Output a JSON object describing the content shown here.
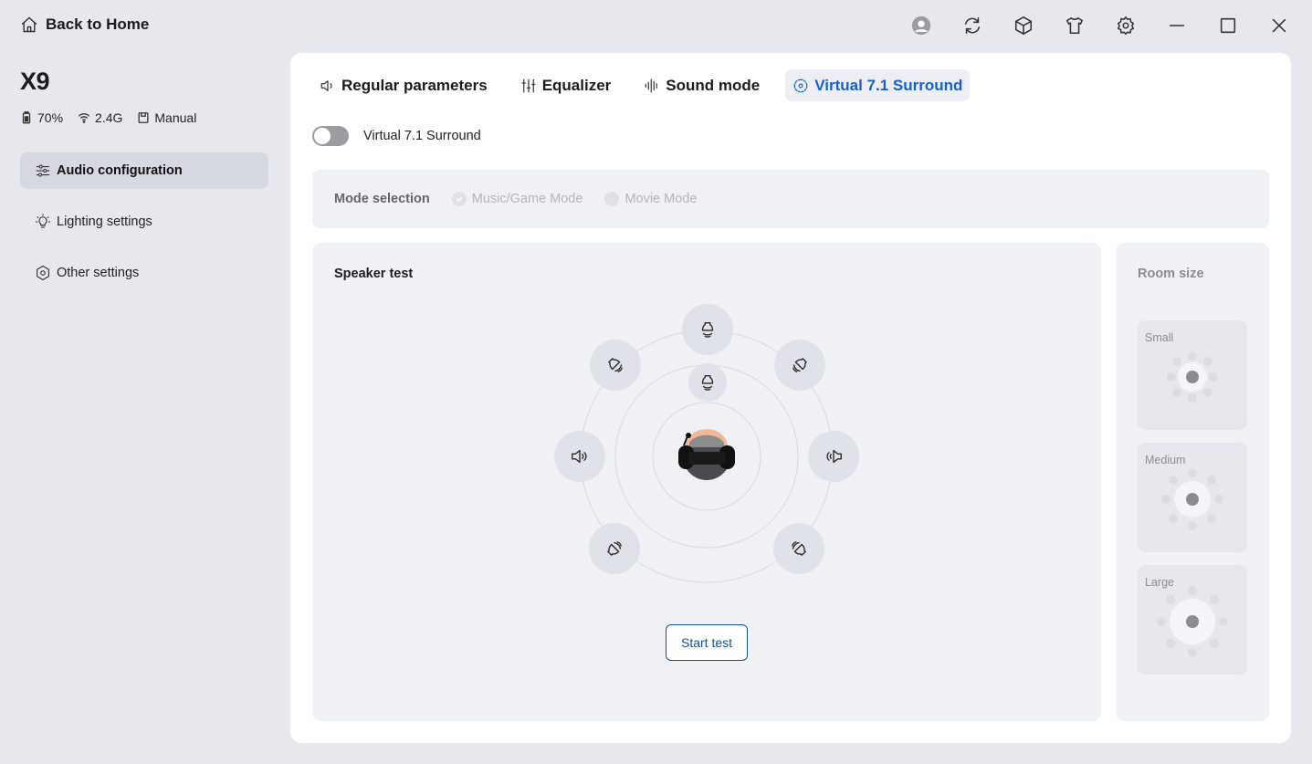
{
  "titlebar": {
    "back_label": "Back to Home",
    "icons": [
      "user-icon",
      "refresh-icon",
      "cube-icon",
      "tshirt-icon",
      "gear-icon",
      "minimize-icon",
      "maximize-icon",
      "close-icon"
    ]
  },
  "device": {
    "name": "X9",
    "battery": "70%",
    "connection": "2.4G",
    "mode": "Manual"
  },
  "sidebar": {
    "items": [
      {
        "label": "Audio configuration",
        "icon": "sliders-icon",
        "active": true
      },
      {
        "label": "Lighting settings",
        "icon": "bulb-icon",
        "active": false
      },
      {
        "label": "Other settings",
        "icon": "hex-settings-icon",
        "active": false
      }
    ]
  },
  "tabs": [
    {
      "label": "Regular parameters",
      "icon": "speaker-icon",
      "active": false
    },
    {
      "label": "Equalizer",
      "icon": "equalizer-icon",
      "active": false
    },
    {
      "label": "Sound mode",
      "icon": "waveform-icon",
      "active": false
    },
    {
      "label": "Virtual 7.1 Surround",
      "icon": "surround-icon",
      "active": true
    }
  ],
  "surround": {
    "toggle_label": "Virtual 7.1 Surround",
    "enabled": false
  },
  "mode_selection": {
    "label": "Mode selection",
    "options": [
      "Music/Game Mode",
      "Movie Mode"
    ],
    "selected": "Music/Game Mode"
  },
  "speaker_test": {
    "title": "Speaker test",
    "start_label": "Start test",
    "speakers": [
      "front-center",
      "front-left",
      "front-right",
      "side-left",
      "side-right",
      "rear-left",
      "rear-right",
      "subwoofer"
    ]
  },
  "room_size": {
    "title": "Room size",
    "options": [
      "Small",
      "Medium",
      "Large"
    ]
  },
  "colors": {
    "accent": "#1a5fd0",
    "background": "#e6e8ee",
    "panel": "#f0f1f5"
  }
}
